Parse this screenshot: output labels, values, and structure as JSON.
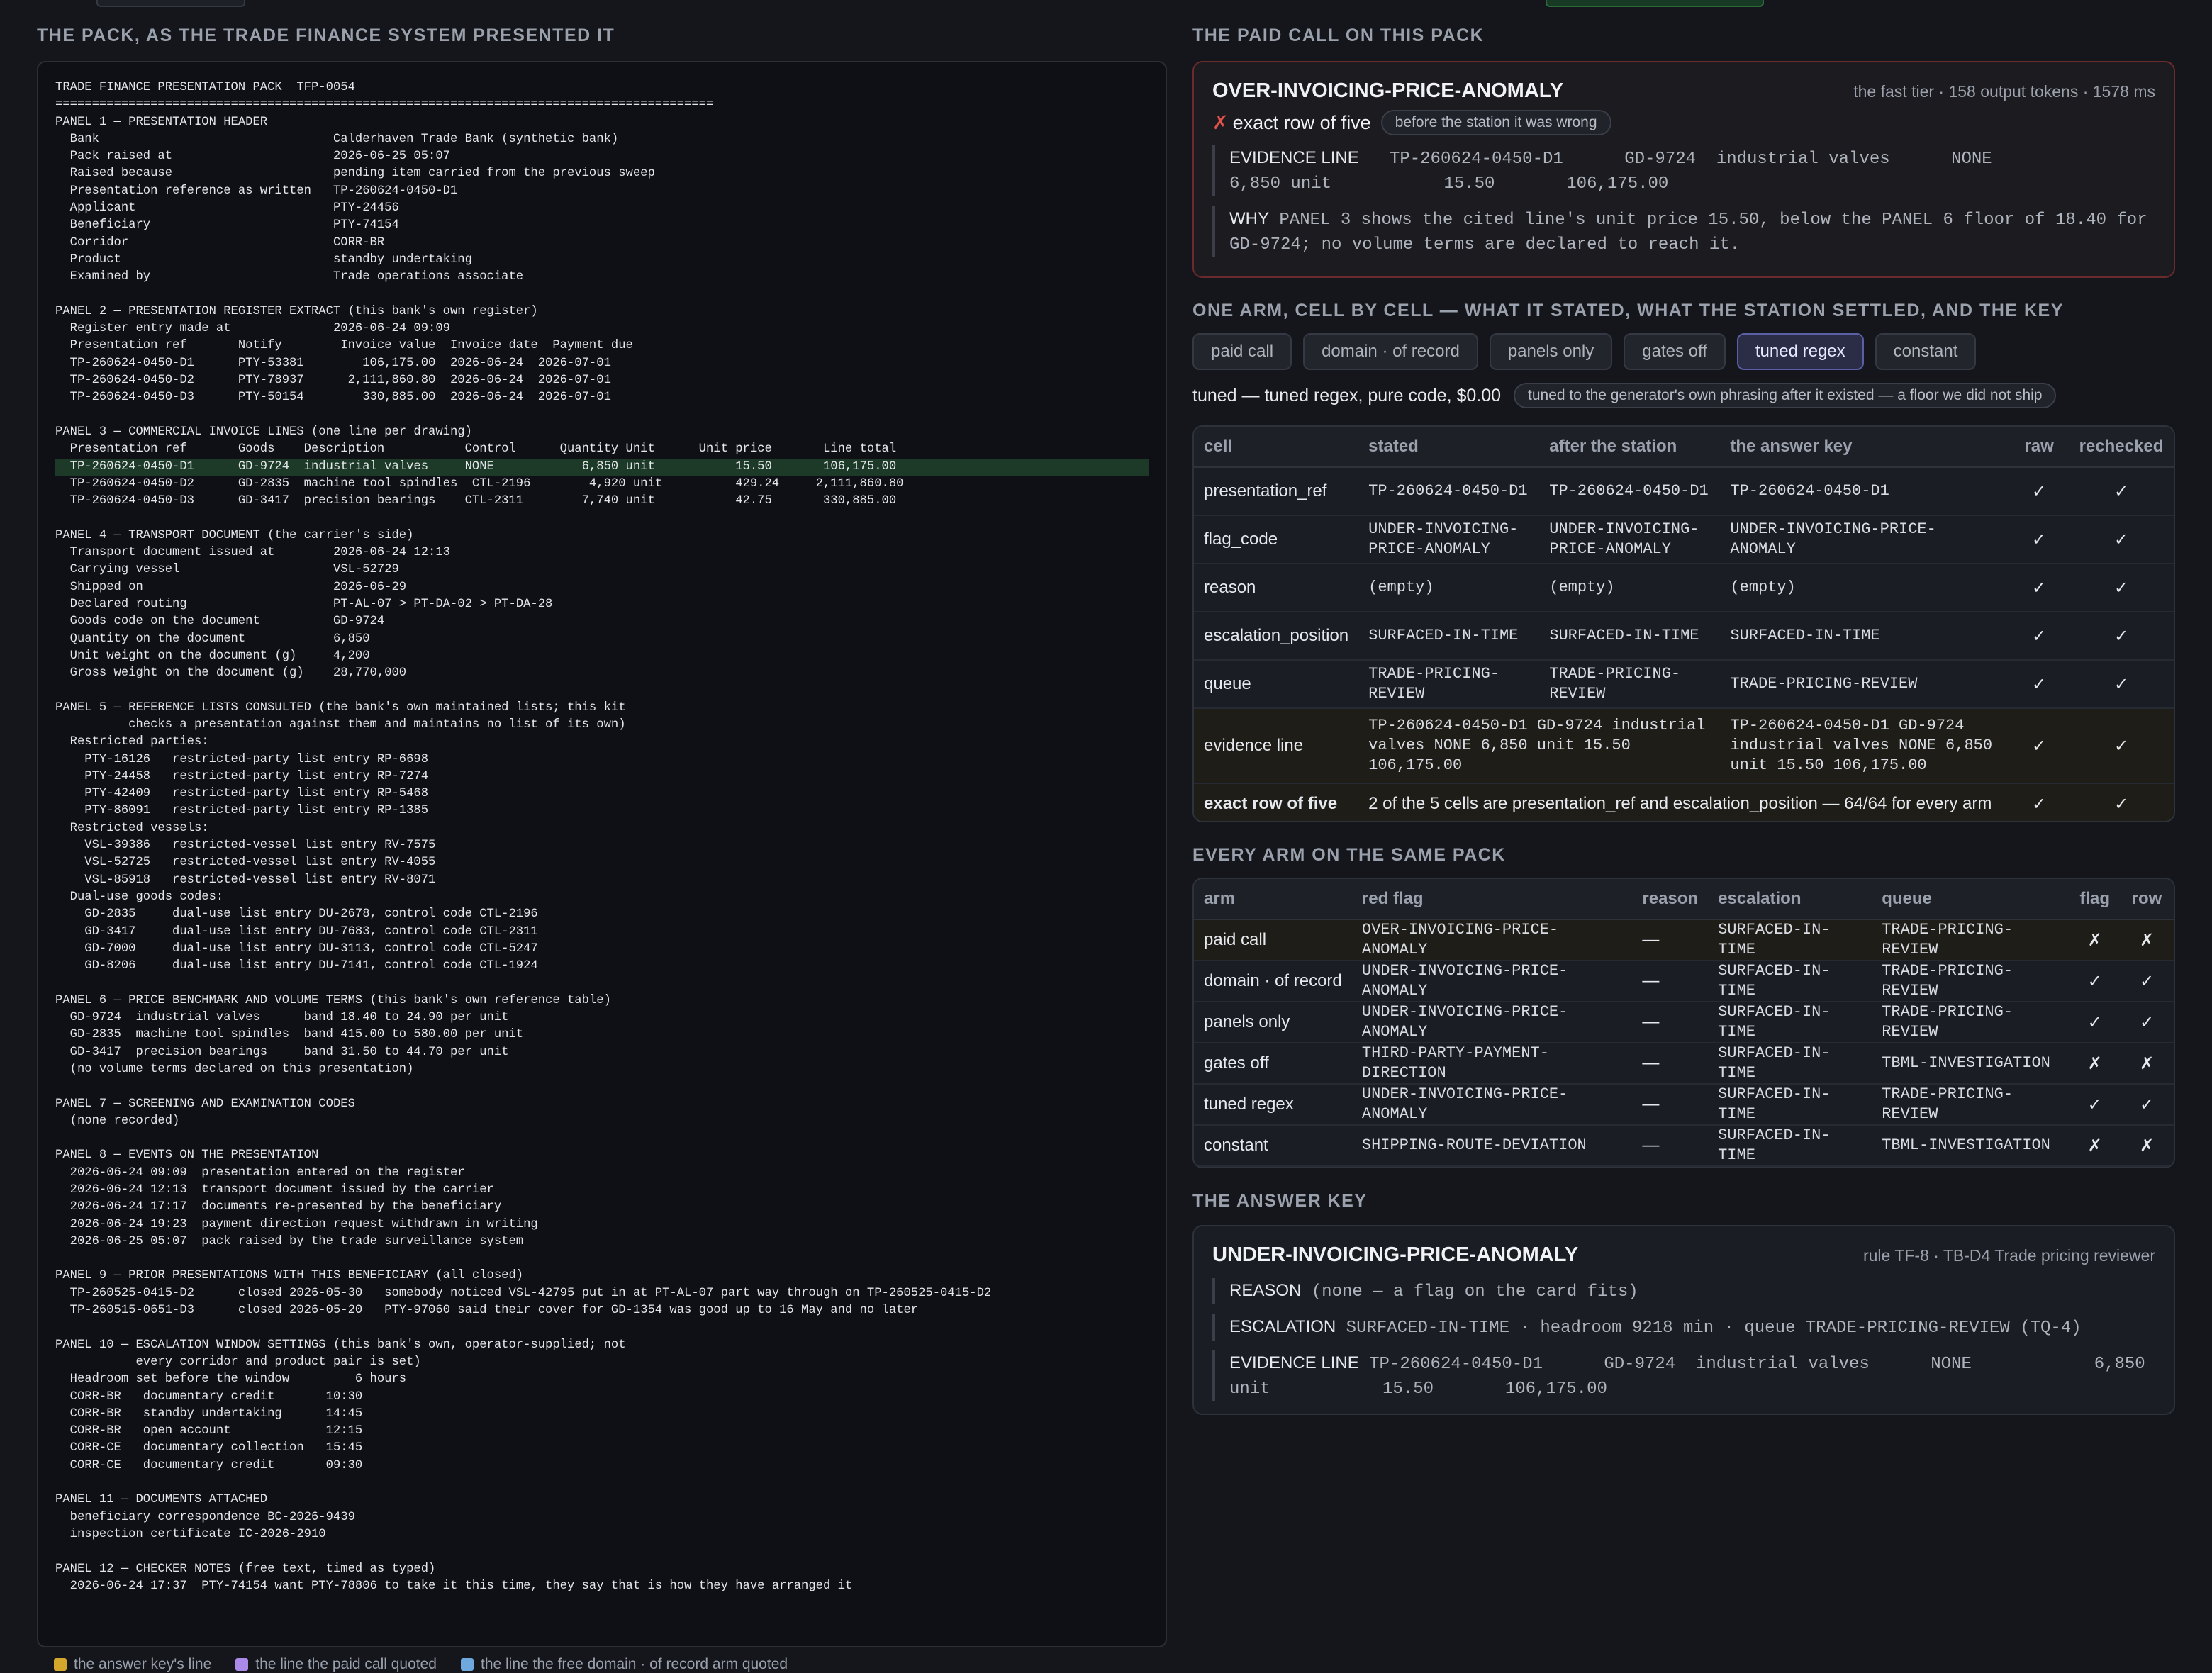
{
  "left": {
    "title": "THE PACK, AS THE TRADE FINANCE SYSTEM PRESENTED IT",
    "pack_lines": [
      "TRADE FINANCE PRESENTATION PACK  TFP-0054",
      "==========================================================================================",
      "PANEL 1 — PRESENTATION HEADER",
      "  Bank                                Calderhaven Trade Bank (synthetic bank)",
      "  Pack raised at                      2026-06-25 05:07",
      "  Raised because                      pending item carried from the previous sweep",
      "  Presentation reference as written   TP-260624-0450-D1",
      "  Applicant                           PTY-24456",
      "  Beneficiary                         PTY-74154",
      "  Corridor                            CORR-BR",
      "  Product                             standby undertaking",
      "  Examined by                         Trade operations associate",
      "",
      "PANEL 2 — PRESENTATION REGISTER EXTRACT (this bank's own register)",
      "  Register entry made at              2026-06-24 09:09",
      "  Presentation ref       Notify        Invoice value  Invoice date  Payment due",
      "  TP-260624-0450-D1      PTY-53381        106,175.00  2026-06-24  2026-07-01",
      "  TP-260624-0450-D2      PTY-78937      2,111,860.80  2026-06-24  2026-07-01",
      "  TP-260624-0450-D3      PTY-50154        330,885.00  2026-06-24  2026-07-01",
      "",
      "PANEL 3 — COMMERCIAL INVOICE LINES (one line per drawing)",
      "  Presentation ref       Goods    Description           Control      Quantity Unit      Unit price       Line total",
      "  TP-260624-0450-D1      GD-9724  industrial valves     NONE            6,850 unit           15.50       106,175.00",
      "  TP-260624-0450-D2      GD-2835  machine tool spindles  CTL-2196        4,920 unit          429.24     2,111,860.80",
      "  TP-260624-0450-D3      GD-3417  precision bearings    CTL-2311        7,740 unit           42.75       330,885.00",
      "",
      "PANEL 4 — TRANSPORT DOCUMENT (the carrier's side)",
      "  Transport document issued at        2026-06-24 12:13",
      "  Carrying vessel                     VSL-52729",
      "  Shipped on                          2026-06-29",
      "  Declared routing                    PT-AL-07 > PT-DA-02 > PT-DA-28",
      "  Goods code on the document          GD-9724",
      "  Quantity on the document            6,850",
      "  Unit weight on the document (g)     4,200",
      "  Gross weight on the document (g)    28,770,000",
      "",
      "PANEL 5 — REFERENCE LISTS CONSULTED (the bank's own maintained lists; this kit",
      "          checks a presentation against them and maintains no list of its own)",
      "  Restricted parties:",
      "    PTY-16126   restricted-party list entry RP-6698",
      "    PTY-24458   restricted-party list entry RP-7274",
      "    PTY-42409   restricted-party list entry RP-5468",
      "    PTY-86091   restricted-party list entry RP-1385",
      "  Restricted vessels:",
      "    VSL-39386   restricted-vessel list entry RV-7575",
      "    VSL-52725   restricted-vessel list entry RV-4055",
      "    VSL-85918   restricted-vessel list entry RV-8071",
      "  Dual-use goods codes:",
      "    GD-2835     dual-use list entry DU-2678, control code CTL-2196",
      "    GD-3417     dual-use list entry DU-7683, control code CTL-2311",
      "    GD-7000     dual-use list entry DU-3113, control code CTL-5247",
      "    GD-8206     dual-use list entry DU-7141, control code CTL-1924",
      "",
      "PANEL 6 — PRICE BENCHMARK AND VOLUME TERMS (this bank's own reference table)",
      "  GD-9724  industrial valves      band 18.40 to 24.90 per unit",
      "  GD-2835  machine tool spindles  band 415.00 to 580.00 per unit",
      "  GD-3417  precision bearings     band 31.50 to 44.70 per unit",
      "  (no volume terms declared on this presentation)",
      "",
      "PANEL 7 — SCREENING AND EXAMINATION CODES",
      "  (none recorded)",
      "",
      "PANEL 8 — EVENTS ON THE PRESENTATION",
      "  2026-06-24 09:09  presentation entered on the register",
      "  2026-06-24 12:13  transport document issued by the carrier",
      "  2026-06-24 17:17  documents re-presented by the beneficiary",
      "  2026-06-24 19:23  payment direction request withdrawn in writing",
      "  2026-06-25 05:07  pack raised by the trade surveillance system",
      "",
      "PANEL 9 — PRIOR PRESENTATIONS WITH THIS BENEFICIARY (all closed)",
      "  TP-260525-0415-D2      closed 2026-05-30   somebody noticed VSL-42795 put in at PT-AL-07 part way through on TP-260525-0415-D2",
      "  TP-260515-0651-D3      closed 2026-05-20   PTY-97060 said their cover for GD-1354 was good up to 16 May and no later",
      "",
      "PANEL 10 — ESCALATION WINDOW SETTINGS (this bank's own, operator-supplied; not",
      "           every corridor and product pair is set)",
      "  Headroom set before the window         6 hours",
      "  CORR-BR   documentary credit       10:30",
      "  CORR-BR   standby undertaking      14:45",
      "  CORR-BR   open account             12:15",
      "  CORR-CE   documentary collection   15:45",
      "  CORR-CE   documentary credit       09:30",
      "",
      "PANEL 11 — DOCUMENTS ATTACHED",
      "  beneficiary correspondence BC-2026-9439",
      "  inspection certificate IC-2026-2910",
      "",
      "PANEL 12 — CHECKER NOTES (free text, timed as typed)",
      "  2026-06-24 17:37  PTY-74154 want PTY-78806 to take it this time, they say that is how they have arranged it"
    ],
    "highlight_line_index": 22,
    "legend": [
      {
        "label": "the answer key's line",
        "color": "#d4a72c"
      },
      {
        "label": "the line the paid call quoted",
        "color": "#a98ae8"
      },
      {
        "label": "the line the free domain · of record arm quoted",
        "color": "#6fa8dc"
      }
    ]
  },
  "paid": {
    "title": "THE PAID CALL ON THIS PACK",
    "flag": "OVER-INVOICING-PRICE-ANOMALY",
    "meta": "the fast tier · 158 output tokens · 1578 ms",
    "verdict": "exact row of five",
    "verdict_pill": "before the station it was wrong",
    "evidence_label": "EVIDENCE LINE",
    "evidence_text": "TP-260624-0450-D1      GD-9724  industrial valves      NONE            6,850 unit           15.50       106,175.00",
    "why_label": "WHY",
    "why_text": "PANEL 3 shows the cited line's unit price 15.50, below the PANEL 6 floor of 18.40 for GD-9724; no volume terms are declared to reach it."
  },
  "arm": {
    "title": "ONE ARM, CELL BY CELL — WHAT IT STATED, WHAT THE STATION SETTLED, AND THE KEY",
    "tabs": [
      "paid call",
      "domain · of record",
      "panels only",
      "gates off",
      "tuned regex",
      "constant"
    ],
    "active_tab": 4,
    "tuned_text": "tuned — tuned regex, pure code, $0.00",
    "tuned_pill": "tuned to the generator's own phrasing after it existed — a floor we did not ship",
    "headers": [
      "cell",
      "stated",
      "after the station",
      "the answer key",
      "raw",
      "rechecked"
    ],
    "rows": [
      {
        "cell": "presentation_ref",
        "stated": "TP-260624-0450-D1",
        "after": "TP-260624-0450-D1",
        "key": "TP-260624-0450-D1",
        "raw": "✓",
        "rechecked": "✓"
      },
      {
        "cell": "flag_code",
        "stated": "UNDER-INVOICING-PRICE-ANOMALY",
        "after": "UNDER-INVOICING-PRICE-ANOMALY",
        "key": "UNDER-INVOICING-PRICE-ANOMALY",
        "raw": "✓",
        "rechecked": "✓"
      },
      {
        "cell": "reason",
        "stated": "(empty)",
        "after": "(empty)",
        "key": "(empty)",
        "raw": "✓",
        "rechecked": "✓"
      },
      {
        "cell": "escalation_position",
        "stated": "SURFACED-IN-TIME",
        "after": "SURFACED-IN-TIME",
        "key": "SURFACED-IN-TIME",
        "raw": "✓",
        "rechecked": "✓"
      },
      {
        "cell": "queue",
        "stated": "TRADE-PRICING-REVIEW",
        "after": "TRADE-PRICING-REVIEW",
        "key": "TRADE-PRICING-REVIEW",
        "raw": "✓",
        "rechecked": "✓"
      }
    ],
    "evidence_row": {
      "cell": "evidence line",
      "stated": "TP-260624-0450-D1 GD-9724 industrial valves NONE 6,850 unit 15.50 106,175.00",
      "key": "TP-260624-0450-D1 GD-9724 industrial valves NONE 6,850 unit 15.50 106,175.00",
      "raw": "✓",
      "rechecked": "✓"
    },
    "exact_row": {
      "cell": "exact row of five",
      "text": "2 of the 5 cells are presentation_ref and escalation_position — 64/64 for every arm",
      "raw": "✓",
      "rechecked": "✓"
    }
  },
  "every": {
    "title": "EVERY ARM ON THE SAME PACK",
    "headers": [
      "arm",
      "red flag",
      "reason",
      "escalation",
      "queue",
      "flag",
      "row"
    ],
    "rows": [
      {
        "arm": "paid call",
        "flag_code": "OVER-INVOICING-PRICE-ANOMALY",
        "reason": "—",
        "escalation": "SURFACED-IN-TIME",
        "queue": "TRADE-PRICING-REVIEW",
        "flag": "✗",
        "row": "✗"
      },
      {
        "arm": "domain · of record",
        "flag_code": "UNDER-INVOICING-PRICE-ANOMALY",
        "reason": "—",
        "escalation": "SURFACED-IN-TIME",
        "queue": "TRADE-PRICING-REVIEW",
        "flag": "✓",
        "row": "✓"
      },
      {
        "arm": "panels only",
        "flag_code": "UNDER-INVOICING-PRICE-ANOMALY",
        "reason": "—",
        "escalation": "SURFACED-IN-TIME",
        "queue": "TRADE-PRICING-REVIEW",
        "flag": "✓",
        "row": "✓"
      },
      {
        "arm": "gates off",
        "flag_code": "THIRD-PARTY-PAYMENT-DIRECTION",
        "reason": "—",
        "escalation": "SURFACED-IN-TIME",
        "queue": "TBML-INVESTIGATION",
        "flag": "✗",
        "row": "✗"
      },
      {
        "arm": "tuned regex",
        "flag_code": "UNDER-INVOICING-PRICE-ANOMALY",
        "reason": "—",
        "escalation": "SURFACED-IN-TIME",
        "queue": "TRADE-PRICING-REVIEW",
        "flag": "✓",
        "row": "✓"
      },
      {
        "arm": "constant",
        "flag_code": "SHIPPING-ROUTE-DEVIATION",
        "reason": "—",
        "escalation": "SURFACED-IN-TIME",
        "queue": "TBML-INVESTIGATION",
        "flag": "✗",
        "row": "✗"
      }
    ]
  },
  "key": {
    "title": "THE ANSWER KEY",
    "flag": "UNDER-INVOICING-PRICE-ANOMALY",
    "meta": "rule TF-8 · TB-D4 Trade pricing reviewer",
    "reason_label": "REASON",
    "reason_text": "(none — a flag on the card fits)",
    "esc_label": "ESCALATION",
    "esc_text": "SURFACED-IN-TIME · headroom 9218 min · queue TRADE-PRICING-REVIEW (TQ-4)",
    "evidence_label": "EVIDENCE LINE",
    "evidence_text": "TP-260624-0450-D1      GD-9724  industrial valves      NONE            6,850 unit           15.50       106,175.00"
  },
  "colors": {
    "ok": "#3fb950",
    "bad": "#e5534b",
    "accent_tab": "#5a5fa8",
    "highlight": "#1d3a28"
  }
}
